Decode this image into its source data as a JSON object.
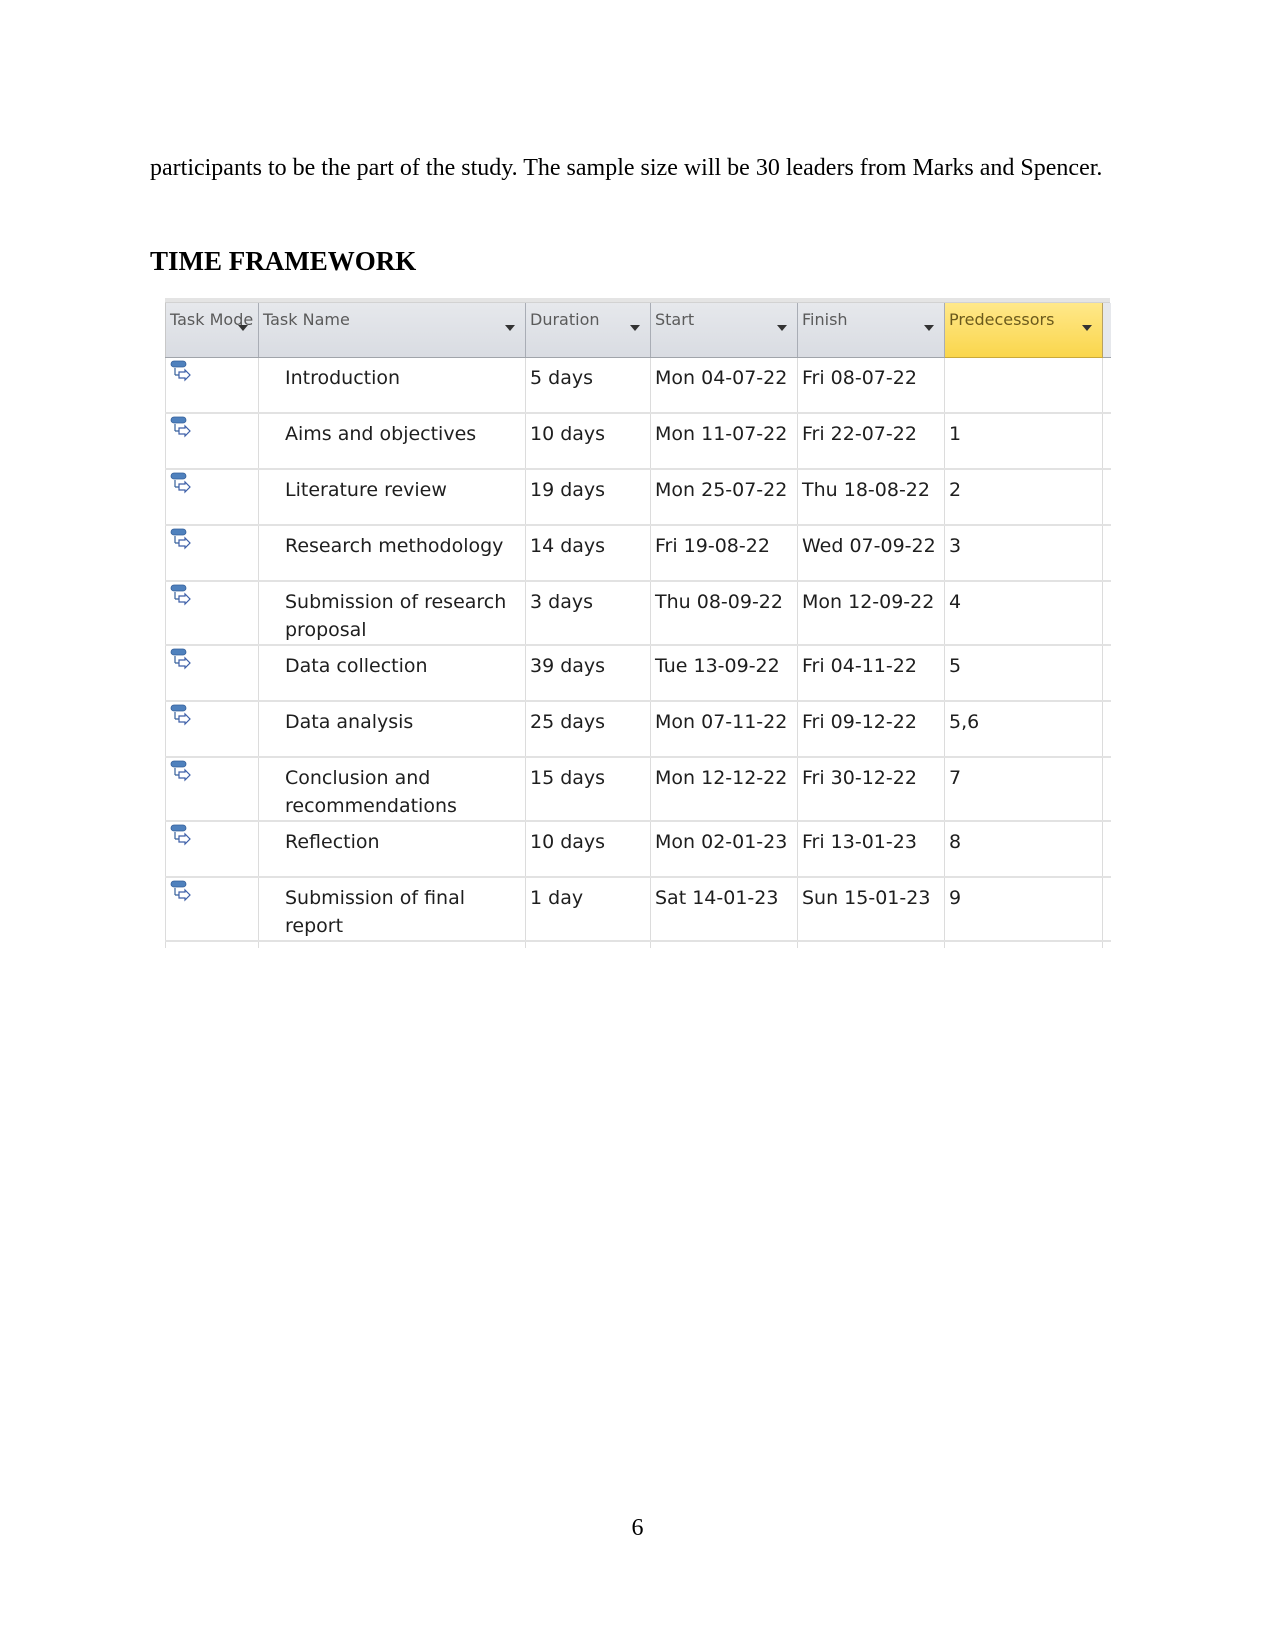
{
  "document": {
    "paragraph": "participants to be the part of the study. The sample size will be 30 leaders from Marks and Spencer.",
    "heading": "TIME FRAMEWORK",
    "page_number": "6"
  },
  "schedule_table": {
    "columns": [
      {
        "label": "Task Mode",
        "has_dropdown": true
      },
      {
        "label": "Task Name",
        "has_dropdown": true
      },
      {
        "label": "Duration",
        "has_dropdown": true
      },
      {
        "label": "Start",
        "has_dropdown": true
      },
      {
        "label": "Finish",
        "has_dropdown": true
      },
      {
        "label": "Predecessors",
        "has_dropdown": true,
        "highlighted": true
      }
    ],
    "header_highlight_color": "#fad64c",
    "task_mode_icon": "auto-scheduled-task-icon",
    "rows": [
      {
        "name": "Introduction",
        "duration": "5 days",
        "start": "Mon 04-07-22",
        "finish": "Fri 08-07-22",
        "predecessors": ""
      },
      {
        "name": "Aims and objectives",
        "duration": "10 days",
        "start": "Mon 11-07-22",
        "finish": "Fri 22-07-22",
        "predecessors": "1"
      },
      {
        "name": "Literature review",
        "duration": "19 days",
        "start": "Mon 25-07-22",
        "finish": "Thu 18-08-22",
        "predecessors": "2"
      },
      {
        "name": "Research methodology",
        "duration": "14 days",
        "start": "Fri 19-08-22",
        "finish": "Wed 07-09-22",
        "predecessors": "3"
      },
      {
        "name": "Submission of research proposal",
        "duration": "3 days",
        "start": "Thu 08-09-22",
        "finish": "Mon 12-09-22",
        "predecessors": "4"
      },
      {
        "name": "Data collection",
        "duration": "39 days",
        "start": "Tue 13-09-22",
        "finish": "Fri 04-11-22",
        "predecessors": "5"
      },
      {
        "name": "Data analysis",
        "duration": "25 days",
        "start": "Mon 07-11-22",
        "finish": "Fri 09-12-22",
        "predecessors": "5,6"
      },
      {
        "name": "Conclusion and recommendations",
        "duration": "15 days",
        "start": "Mon 12-12-22",
        "finish": "Fri 30-12-22",
        "predecessors": "7"
      },
      {
        "name": "Reflection",
        "duration": "10 days",
        "start": "Mon 02-01-23",
        "finish": "Fri 13-01-23",
        "predecessors": "8"
      },
      {
        "name": "Submission of final report",
        "duration": "1 day",
        "start": "Sat 14-01-23",
        "finish": "Sun 15-01-23",
        "predecessors": "9"
      }
    ]
  }
}
